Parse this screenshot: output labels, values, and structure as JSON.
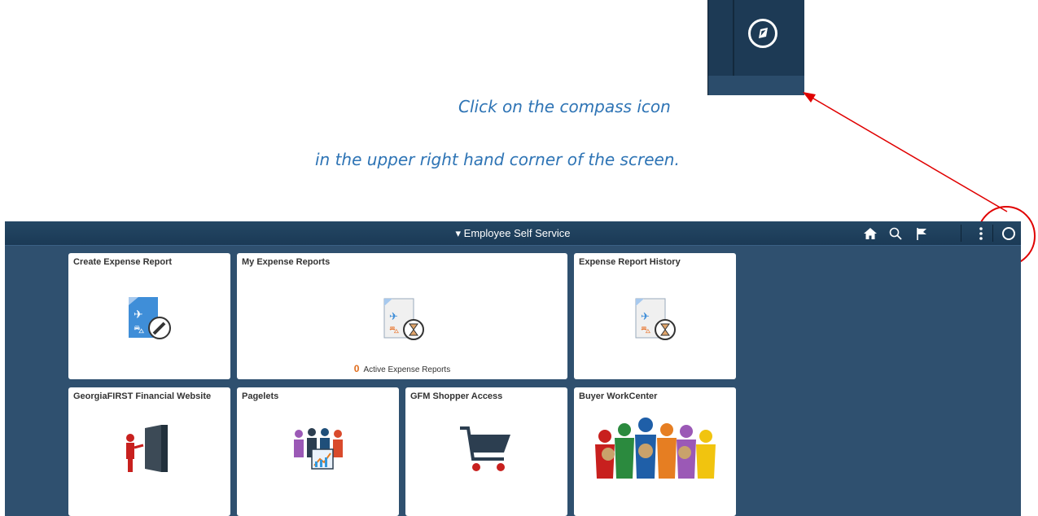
{
  "instructions": {
    "line1": "Click on the compass icon",
    "line2": "in the upper right hand corner of the screen."
  },
  "colors": {
    "instruction_text": "#2e74b5",
    "annotation": "#e00000",
    "app_background": "#2f506f",
    "header": "#1d3a55",
    "count_accent": "#e06c1b"
  },
  "header": {
    "title": "▾ Employee Self Service",
    "icons": [
      "home-icon",
      "search-icon",
      "flag-icon",
      "action-menu-icon",
      "navbar-compass-icon"
    ]
  },
  "tiles": [
    {
      "title": "Create Expense Report",
      "icon": "expense-report-edit-icon"
    },
    {
      "title": "My Expense Reports",
      "icon": "expense-report-hourglass-icon",
      "count": "0",
      "count_label": "Active Expense Reports"
    },
    {
      "title": "Expense Report History",
      "icon": "expense-report-hourglass-icon"
    },
    {
      "title": "GeorgiaFIRST Financial Website",
      "icon": "door-person-icon"
    },
    {
      "title": "Pagelets",
      "icon": "people-chart-icon"
    },
    {
      "title": "GFM Shopper Access",
      "icon": "shopping-cart-icon"
    },
    {
      "title": "Buyer WorkCenter",
      "icon": "buyers-people-icon"
    }
  ]
}
